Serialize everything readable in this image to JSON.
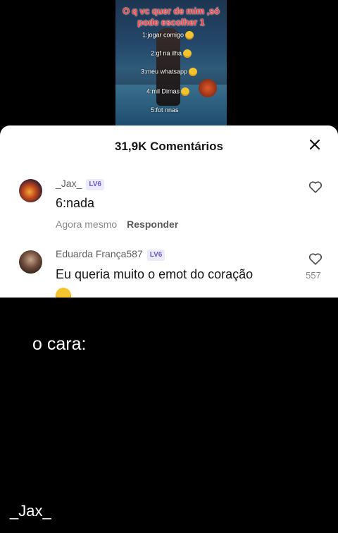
{
  "video": {
    "title_line1": "O q vc quer de mim ,só",
    "title_line2": "pode escolher 1",
    "options": [
      "1:jogar comigo",
      "2:gf na ilha",
      "3:meu whatsapp",
      "4:mil Dimas",
      "5:fot nnas"
    ]
  },
  "sheet": {
    "title": "31,9K Comentários"
  },
  "comments": [
    {
      "username": "_Jax_",
      "level": "LV6",
      "text": "6:nada",
      "time": "Agora mesmo",
      "reply_label": "Responder",
      "likes": ""
    },
    {
      "username": "Eduarda França587",
      "level": "LV6",
      "text": "Eu queria muito o emot do coração",
      "likes": "557"
    }
  ],
  "overlay": {
    "caption": "o cara:",
    "author": "_Jax_"
  }
}
